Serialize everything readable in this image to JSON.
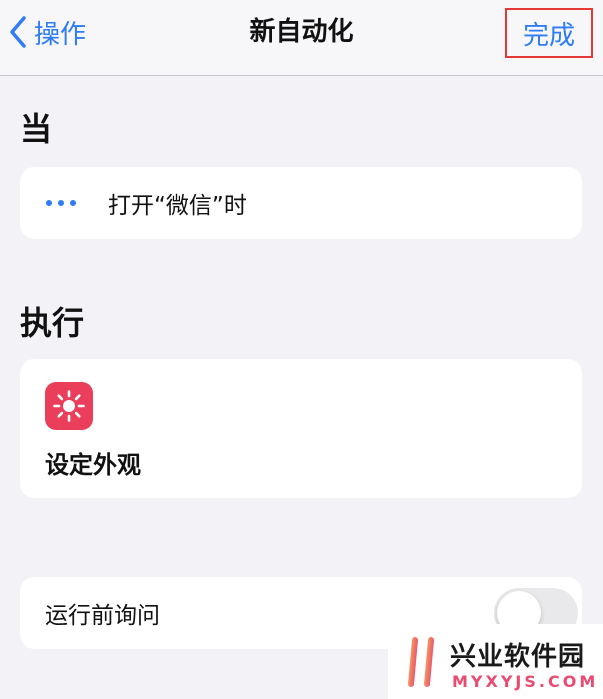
{
  "nav": {
    "back_label": "操作",
    "title": "新自动化",
    "done_label": "完成"
  },
  "sections": {
    "when_title": "当",
    "do_title": "执行"
  },
  "trigger": {
    "icon": "more-icon",
    "text": "打开“微信”时"
  },
  "action": {
    "icon": "sun-icon",
    "icon_color": "#ea3e5a",
    "label": "设定外观"
  },
  "ask_before_running": {
    "label": "运行前询问",
    "enabled": false
  },
  "watermark": {
    "text_cn": "兴业软件园",
    "text_en": "MYXYJS.COM"
  },
  "colors": {
    "accent": "#2f7cf6",
    "highlight_border": "#e53935",
    "background": "#f2f2f7"
  }
}
